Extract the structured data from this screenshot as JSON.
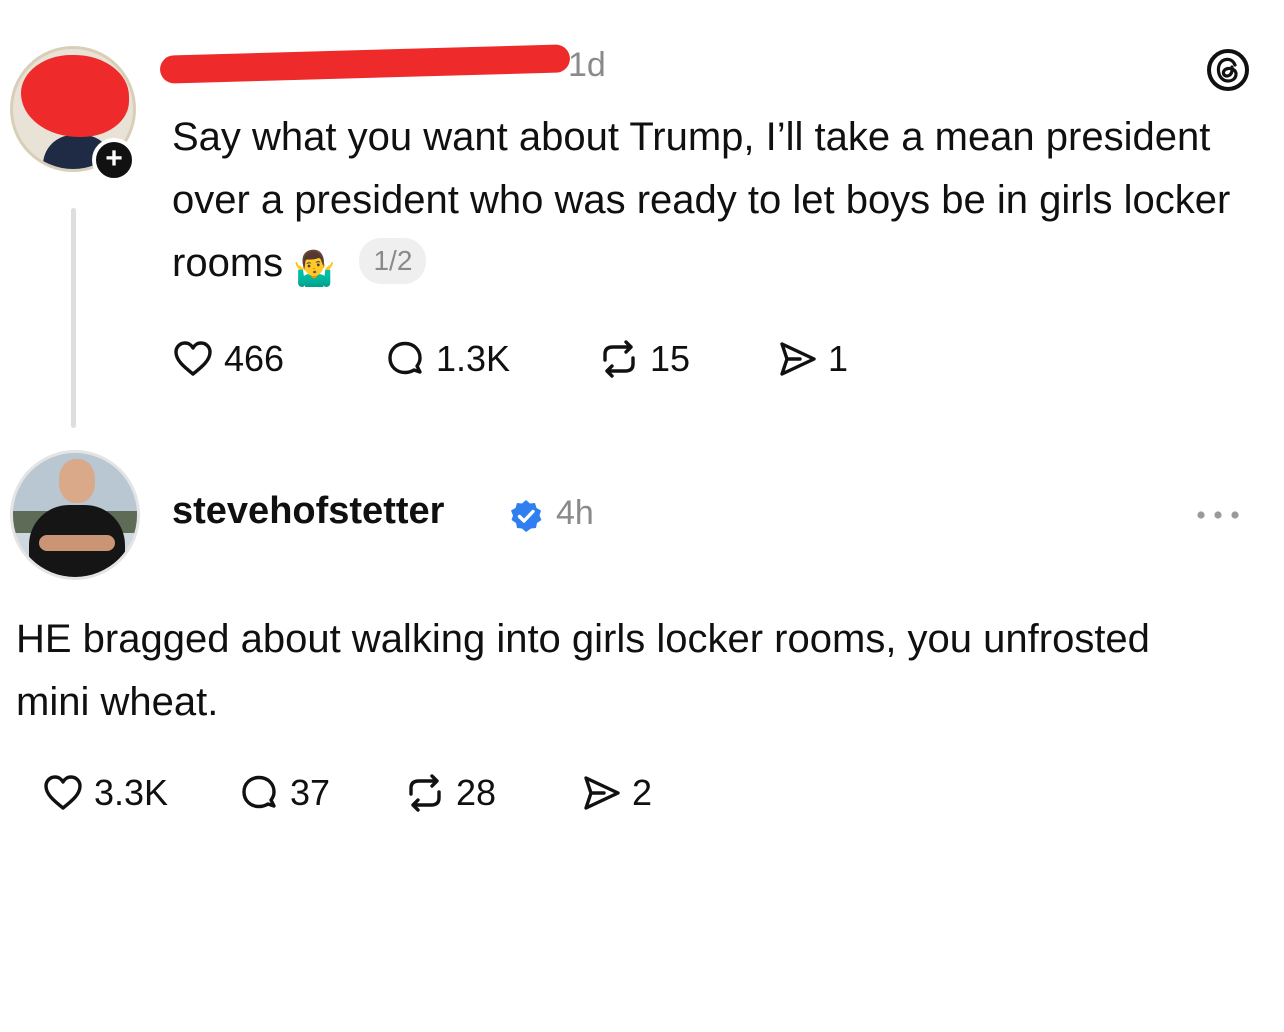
{
  "post1": {
    "time": "1d",
    "text": "Say what you want about Trump, I’ll take a mean president over a president who was ready to let boys be in girls locker rooms",
    "emoji": "🤷‍♂️",
    "page_indicator": "1/2",
    "actions": {
      "likes": "466",
      "replies": "1.3K",
      "reposts": "15",
      "shares": "1"
    }
  },
  "post2": {
    "username": "stevehofstetter",
    "time": "4h",
    "text": "HE bragged about walking into girls locker rooms, you unfrosted mini wheat.",
    "actions": {
      "likes": "3.3K",
      "replies": "37",
      "reposts": "28",
      "shares": "2"
    }
  },
  "icons": {
    "app": "threads-icon",
    "like": "heart-icon",
    "reply": "comment-icon",
    "repost": "repost-icon",
    "share": "send-icon",
    "verified": "verified-badge-icon",
    "more": "more-options-icon",
    "follow": "plus-icon"
  },
  "colors": {
    "redaction": "#ee2a2a",
    "verified": "#2f7ff0",
    "secondary_text": "#8a8a8a"
  }
}
